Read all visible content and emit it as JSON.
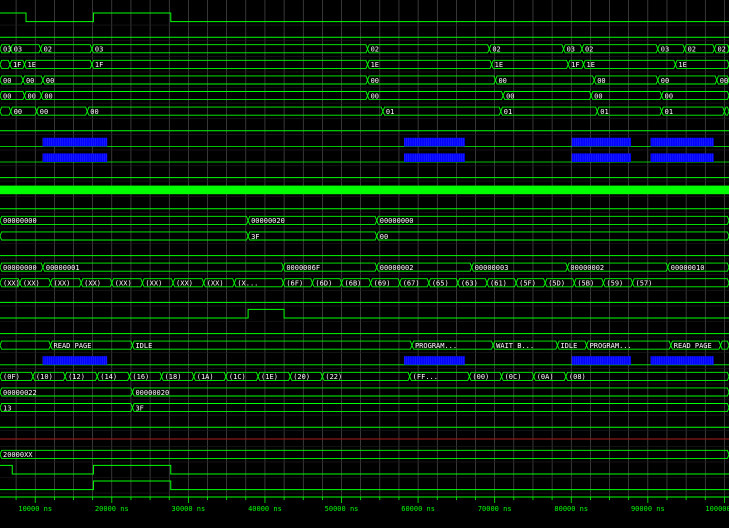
{
  "colors": {
    "background": "#000000",
    "grid": "#5a5a5a",
    "signal": "#00ff00",
    "bus_fill": "#0000ff",
    "highlight_bar": "#00ff00",
    "red_line": "#8b1a1a",
    "text": "#ffffff"
  },
  "time_axis": {
    "range_ns": [
      5400,
      100600
    ],
    "ticks": [
      "10000 ns",
      "20000 ns",
      "30000 ns",
      "40000 ns",
      "50000 ns",
      "60000 ns",
      "70000 ns",
      "80000 ns",
      "90000 ns",
      "100000 ns"
    ],
    "tick_values": [
      10000,
      20000,
      30000,
      40000,
      50000,
      60000,
      70000,
      80000,
      90000,
      100000
    ]
  },
  "rows": [
    {
      "kind": "signal",
      "edges": [
        [
          5400,
          1
        ],
        [
          8800,
          0
        ],
        [
          17600,
          1
        ],
        [
          27700,
          0
        ]
      ]
    },
    {
      "kind": "signal",
      "edges": [
        [
          5400,
          0
        ]
      ]
    },
    {
      "kind": "bus",
      "values": [
        [
          5400,
          "03"
        ],
        [
          6800,
          "03"
        ],
        [
          10700,
          "02"
        ],
        [
          17400,
          "03"
        ],
        [
          53400,
          "02"
        ],
        [
          69300,
          "02"
        ],
        [
          79000,
          "03"
        ],
        [
          81400,
          "02"
        ],
        [
          91300,
          "03"
        ],
        [
          94800,
          "02"
        ],
        [
          98700,
          "02"
        ],
        [
          100600,
          "02"
        ]
      ]
    },
    {
      "kind": "bus",
      "values": [
        [
          5400,
          ""
        ],
        [
          6700,
          "1F"
        ],
        [
          8600,
          "1E"
        ],
        [
          17400,
          "1F"
        ],
        [
          53400,
          "1E"
        ],
        [
          69600,
          "1E"
        ],
        [
          79600,
          "1F"
        ],
        [
          81600,
          "1E"
        ],
        [
          93600,
          "1E"
        ]
      ]
    },
    {
      "kind": "bus",
      "values": [
        [
          5400,
          "00"
        ],
        [
          8400,
          "00"
        ],
        [
          11000,
          "00"
        ],
        [
          53400,
          "00"
        ],
        [
          70100,
          "00"
        ],
        [
          83000,
          "00"
        ],
        [
          91300,
          "00"
        ],
        [
          99000,
          "00"
        ]
      ]
    },
    {
      "kind": "bus",
      "values": [
        [
          5400,
          "00"
        ],
        [
          8600,
          "00"
        ],
        [
          10800,
          "00"
        ],
        [
          53400,
          "00"
        ],
        [
          71100,
          "00"
        ],
        [
          82600,
          "00"
        ],
        [
          91800,
          "00"
        ]
      ]
    },
    {
      "kind": "bus",
      "values": [
        [
          5400,
          ""
        ],
        [
          6800,
          "00"
        ],
        [
          10200,
          "00"
        ],
        [
          16800,
          "00"
        ],
        [
          55400,
          "01"
        ],
        [
          70800,
          "01"
        ],
        [
          83400,
          "01"
        ],
        [
          91800,
          "01"
        ],
        [
          100000,
          "01"
        ]
      ]
    },
    {
      "kind": "signal",
      "edges": [
        [
          5400,
          0
        ]
      ]
    },
    {
      "kind": "dense",
      "blocks": [
        [
          11000,
          19400
        ],
        [
          58200,
          66100
        ],
        [
          80100,
          87800
        ],
        [
          90400,
          98600
        ]
      ]
    },
    {
      "kind": "dense",
      "blocks": [
        [
          11000,
          19400
        ],
        [
          58200,
          66100
        ],
        [
          80100,
          87800
        ],
        [
          90400,
          98600
        ]
      ]
    },
    {
      "kind": "signal",
      "edges": [
        [
          5400,
          0
        ]
      ]
    },
    {
      "kind": "highlight"
    },
    {
      "kind": "signal",
      "edges": [
        [
          5400,
          0
        ]
      ]
    },
    {
      "kind": "bus",
      "values": [
        [
          5400,
          "00000000"
        ],
        [
          37800,
          "00000020"
        ],
        [
          54600,
          "00000000"
        ]
      ]
    },
    {
      "kind": "bus",
      "values": [
        [
          5400,
          ""
        ],
        [
          37800,
          "3F"
        ],
        [
          54600,
          "00"
        ]
      ]
    },
    {
      "kind": "signal",
      "edges": [
        [
          5400,
          0
        ]
      ]
    },
    {
      "kind": "bus",
      "values": [
        [
          5400,
          "00000000"
        ],
        [
          11000,
          "00000001"
        ],
        [
          42400,
          "0000006F"
        ],
        [
          54600,
          "00000002"
        ],
        [
          67000,
          "00000003"
        ],
        [
          79500,
          "00000002"
        ],
        [
          92600,
          "00000010"
        ]
      ]
    },
    {
      "kind": "bus",
      "values": [
        [
          5400,
          "(XX)"
        ],
        [
          8000,
          "(XX)"
        ],
        [
          12000,
          "(XX)"
        ],
        [
          16000,
          "(XX)"
        ],
        [
          20000,
          "(XX)"
        ],
        [
          24000,
          "(XX)"
        ],
        [
          28000,
          "(XX)"
        ],
        [
          32000,
          "(XX)"
        ],
        [
          36000,
          "(X..."
        ],
        [
          42400,
          "(6F)"
        ],
        [
          46200,
          "(6D)"
        ],
        [
          50000,
          "(6B)"
        ],
        [
          53800,
          "(69)"
        ],
        [
          57600,
          "(67)"
        ],
        [
          61400,
          "(65)"
        ],
        [
          65200,
          "(63)"
        ],
        [
          69000,
          "(61)"
        ],
        [
          72800,
          "(5F)"
        ],
        [
          76600,
          "(5D)"
        ],
        [
          80400,
          "(5B)"
        ],
        [
          84200,
          "(59)"
        ],
        [
          88000,
          "(57)"
        ]
      ]
    },
    {
      "kind": "signal",
      "edges": [
        [
          5400,
          0
        ]
      ]
    },
    {
      "kind": "signal",
      "edges": [
        [
          5400,
          0
        ],
        [
          37800,
          1
        ],
        [
          42500,
          0
        ]
      ]
    },
    {
      "kind": "signal",
      "edges": [
        [
          5400,
          0
        ]
      ]
    },
    {
      "kind": "bus",
      "values": [
        [
          5400,
          ""
        ],
        [
          12000,
          "READ PAGE"
        ],
        [
          22700,
          "IDLE"
        ],
        [
          59200,
          "PROGRAM..."
        ],
        [
          69800,
          "WAIT B..."
        ],
        [
          78200,
          "IDLE"
        ],
        [
          82000,
          "PROGRAM..."
        ],
        [
          93000,
          "READ PAGE"
        ],
        [
          99500,
          "READ PAGE"
        ]
      ]
    },
    {
      "kind": "dense",
      "blocks": [
        [
          11000,
          19400
        ],
        [
          58200,
          66100
        ],
        [
          80100,
          87800
        ],
        [
          90400,
          98600
        ]
      ]
    },
    {
      "kind": "bus",
      "values": [
        [
          5400,
          "(0F)"
        ],
        [
          9700,
          "(10)"
        ],
        [
          13900,
          "(12)"
        ],
        [
          18100,
          "(14)"
        ],
        [
          22300,
          "(16)"
        ],
        [
          26500,
          "(18)"
        ],
        [
          30700,
          "(1A)"
        ],
        [
          34900,
          "(1C)"
        ],
        [
          39100,
          "(1E)"
        ],
        [
          43300,
          "(20)"
        ],
        [
          47500,
          "(22)"
        ],
        [
          58900,
          "(FF..."
        ],
        [
          66700,
          "(00)"
        ],
        [
          70900,
          "(0C)"
        ],
        [
          75100,
          "(0A)"
        ],
        [
          79300,
          "(08)"
        ]
      ]
    },
    {
      "kind": "bus",
      "values": [
        [
          5400,
          "00000022"
        ],
        [
          22700,
          "00000020"
        ]
      ]
    },
    {
      "kind": "bus",
      "values": [
        [
          5400,
          "13"
        ],
        [
          22700,
          "3F"
        ]
      ]
    },
    {
      "kind": "signal",
      "edges": [
        [
          5400,
          0
        ]
      ]
    },
    {
      "kind": "red"
    },
    {
      "kind": "bus",
      "values": [
        [
          5400,
          "20000XX"
        ]
      ]
    },
    {
      "kind": "signal",
      "edges": [
        [
          5400,
          1
        ],
        [
          7000,
          0
        ],
        [
          17600,
          1
        ],
        [
          27700,
          0
        ]
      ]
    },
    {
      "kind": "signal",
      "edges": [
        [
          5400,
          0
        ],
        [
          17600,
          1
        ],
        [
          27700,
          0
        ]
      ]
    }
  ]
}
